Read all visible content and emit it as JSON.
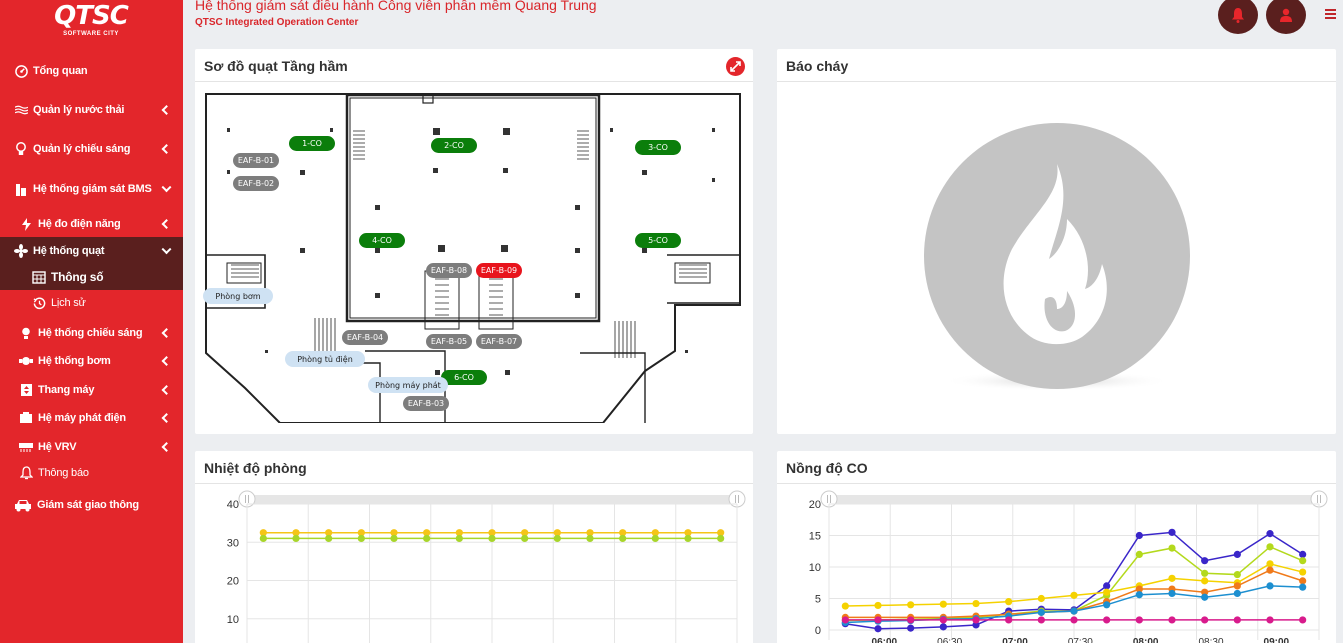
{
  "logo": {
    "mark": "QTSC",
    "sub": "SOFTWARE CITY"
  },
  "header": {
    "title": "Hệ thống giám sát điều hành Công viên phần mềm Quang Trung",
    "subtitle": "QTSC Integrated Operation Center"
  },
  "sidebar": {
    "items": [
      {
        "label": "Tổng quan",
        "icon": "dashboard-icon"
      },
      {
        "label": "Quản lý nước thải",
        "icon": "water-icon"
      },
      {
        "label": "Quản lý chiếu sáng",
        "icon": "lightbulb-icon"
      },
      {
        "label": "Hệ thống giám sát BMS",
        "icon": "building-icon"
      },
      {
        "label": "Hệ đo điện năng",
        "icon": "bolt-icon"
      },
      {
        "label": "Hệ thống quạt",
        "icon": "fan-icon"
      },
      {
        "label": "Thông số",
        "icon": "calendar-icon"
      },
      {
        "label": "Lịch sử",
        "icon": "history-icon"
      },
      {
        "label": "Hệ thống chiếu sáng",
        "icon": "lightbulb-icon"
      },
      {
        "label": "Hệ thống bơm",
        "icon": "pump-icon"
      },
      {
        "label": "Thang máy",
        "icon": "elevator-icon"
      },
      {
        "label": "Hệ máy phát điện",
        "icon": "generator-icon"
      },
      {
        "label": "Hệ VRV",
        "icon": "ac-icon"
      },
      {
        "label": "Thông báo",
        "icon": "bell-icon"
      },
      {
        "label": "Giám sát giao thông",
        "icon": "car-icon"
      }
    ]
  },
  "panels": {
    "fan_map": {
      "title": "Sơ đồ quạt Tầng hầm",
      "co_sensors": [
        "1-CO",
        "2-CO",
        "3-CO",
        "4-CO",
        "5-CO",
        "6-CO"
      ],
      "fans": [
        "EAF-B-01",
        "EAF-B-02",
        "EAF-B-08",
        "EAF-B-09",
        "EAF-B-04",
        "EAF-B-05",
        "EAF-B-07",
        "EAF-B-03"
      ],
      "rooms": [
        "Phòng bơm",
        "Phòng tủ điện",
        "Phòng máy phát"
      ]
    },
    "fire": {
      "title": "Báo cháy"
    },
    "temperature": {
      "title": "Nhiệt độ phòng"
    },
    "co": {
      "title": "Nồng độ CO"
    }
  },
  "colors": {
    "sidebar": "#e3262b",
    "active": "#5a1f1e",
    "sensor_ok": "#0b7e0b",
    "fan_off": "#7d7d7d",
    "fan_alarm": "#e8141d"
  },
  "chart_data": [
    {
      "type": "line",
      "title": "Nhiệt độ phòng",
      "ylim": [
        0,
        40
      ],
      "yticks": [
        10,
        20,
        30,
        40
      ],
      "series": [
        {
          "color": "#f5c518",
          "values": [
            32.5,
            32.5,
            32.5,
            32.5,
            32.5,
            32.5,
            32.5,
            32.5,
            32.5,
            32.5,
            32.5,
            32.5,
            32.5,
            32.5,
            32.5
          ]
        },
        {
          "color": "#a8d62a",
          "values": [
            31,
            31,
            31,
            31,
            31,
            31,
            31,
            31,
            31,
            31,
            31,
            31,
            31,
            31,
            31
          ]
        }
      ]
    },
    {
      "type": "line",
      "title": "Nồng độ CO",
      "ylim": [
        0,
        20
      ],
      "yticks": [
        0,
        5,
        10,
        15,
        20
      ],
      "x_tick_labels": [
        "06:00",
        "06:30",
        "07:00",
        "07:30",
        "08:00",
        "08:30",
        "09:00"
      ],
      "series": [
        {
          "color": "#3a26c9",
          "values": [
            1,
            0.2,
            0.3,
            0.5,
            0.8,
            3,
            3.3,
            3.2,
            7,
            15,
            15.5,
            11,
            12,
            15.3,
            12
          ]
        },
        {
          "color": "#b3d91c",
          "values": [
            1.5,
            1.6,
            1.7,
            1.8,
            2,
            2.5,
            3,
            3,
            5.5,
            12,
            13,
            9,
            8.8,
            13.2,
            11
          ]
        },
        {
          "color": "#f5d200",
          "values": [
            3.8,
            3.9,
            4,
            4.1,
            4.2,
            4.5,
            5,
            5.5,
            6,
            7,
            8.2,
            7.8,
            7.5,
            10.5,
            9.2
          ]
        },
        {
          "color": "#f07a1a",
          "values": [
            2,
            2,
            2,
            2,
            2.2,
            2.5,
            2.8,
            3,
            4.5,
            6.5,
            6.5,
            6,
            7,
            9.5,
            7.8
          ]
        },
        {
          "color": "#1d8fd0",
          "values": [
            1.2,
            1.4,
            1.5,
            1.7,
            1.8,
            2.2,
            2.8,
            3,
            4,
            5.6,
            5.8,
            5.2,
            5.8,
            7,
            6.8
          ]
        },
        {
          "color": "#d81b8c",
          "values": [
            1.6,
            1.6,
            1.6,
            1.6,
            1.6,
            1.6,
            1.6,
            1.6,
            1.6,
            1.6,
            1.6,
            1.6,
            1.6,
            1.6,
            1.6
          ]
        }
      ]
    }
  ]
}
